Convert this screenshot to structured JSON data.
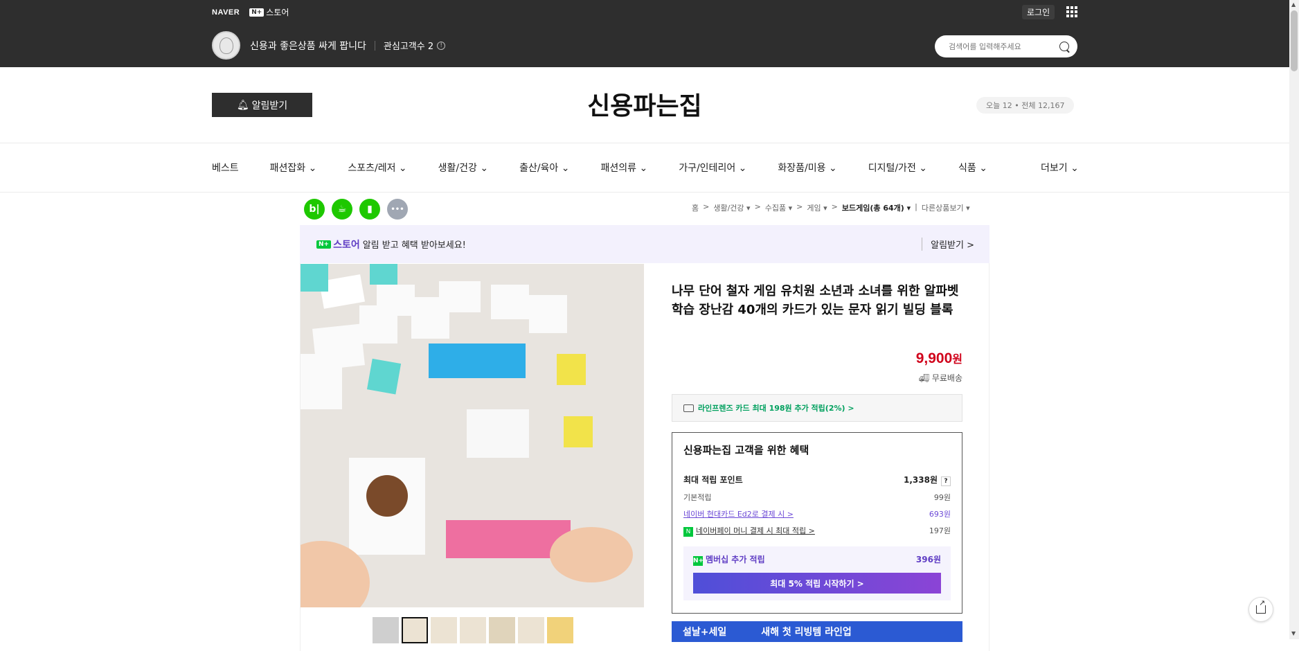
{
  "header": {
    "naver_logo": "NAVER",
    "np_box": "N+",
    "store_logo": "스토어",
    "login_label": "로그인",
    "apps_icon": "grid-icon"
  },
  "store": {
    "slogan": "신용과 좋은상품 싸게 팝니다",
    "fans_label": "관심고객수 2",
    "search_placeholder": "검색어를 입력해주세요",
    "alarm_label": "알림받기",
    "title": "신용파는집",
    "visitors": "오늘 12 • 전체 12,167"
  },
  "categories": [
    "베스트",
    "패션잡화 ⌄",
    "스포츠/레저 ⌄",
    "생활/건강 ⌄",
    "출산/육아 ⌄",
    "패션의류 ⌄",
    "가구/인테리어 ⌄",
    "화장품/미용 ⌄",
    "디지털/가전 ⌄",
    "식품 ⌄"
  ],
  "more_label": "더보기 ⌄",
  "sns": [
    {
      "label": "b|",
      "color": "#1ec800",
      "icon": "blog-icon"
    },
    {
      "label": "☕",
      "color": "#1ec800",
      "icon": "cafe-icon"
    },
    {
      "label": "▮",
      "color": "#1ec800",
      "icon": "bookmark-icon"
    },
    {
      "label": "•••",
      "color": "#a0a7b3",
      "icon": "more-icon"
    }
  ],
  "breadcrumb": [
    "홈",
    ">",
    "생활/건강 ▾",
    ">",
    "수집품 ▾",
    ">",
    "게임 ▾",
    ">",
    "보드게임(총 64개) ▾",
    "|",
    "다른상품보기 ▾"
  ],
  "promo": {
    "store": "스토어",
    "text": "알림 받고 혜택 받아보세요!",
    "alarm": "알림받기 >"
  },
  "product": {
    "title": "나무 단어 철자 게임 유치원 소년과 소녀를 위한 알파벳 학습 장난감 40개의 카드가 있는 문자 읽기 빌딩 블록",
    "price": "9,900",
    "price_unit": "원",
    "shipping": "무료배송"
  },
  "card_benefit": "라인프렌즈 카드 최대 198원 추가 적립(2%) >",
  "benefits": {
    "title": "신용파는집 고객을 위한 혜택",
    "max_label": "최대 적립 포인트",
    "max_value": "1,338원",
    "rows": [
      {
        "label": "기본적립",
        "value": "99원"
      },
      {
        "label": "네이버 현대카드 Ed2로 결제 시 >",
        "value": "693원"
      },
      {
        "label": "네이버페이 머니 결제 시 최대 적립 >",
        "value": "197원"
      }
    ],
    "member_label": "멤버십 추가 적립",
    "member_value": "396원",
    "member_button": "최대 5% 적립 시작하기 >"
  },
  "banner": {
    "left": "설날+세일",
    "text": "새해 첫 리빙템 라인업"
  },
  "colors": {
    "topbar": "#2e2e2e",
    "price": "#d0021b",
    "accent": "#5f3dc4",
    "green": "#00c73c"
  }
}
